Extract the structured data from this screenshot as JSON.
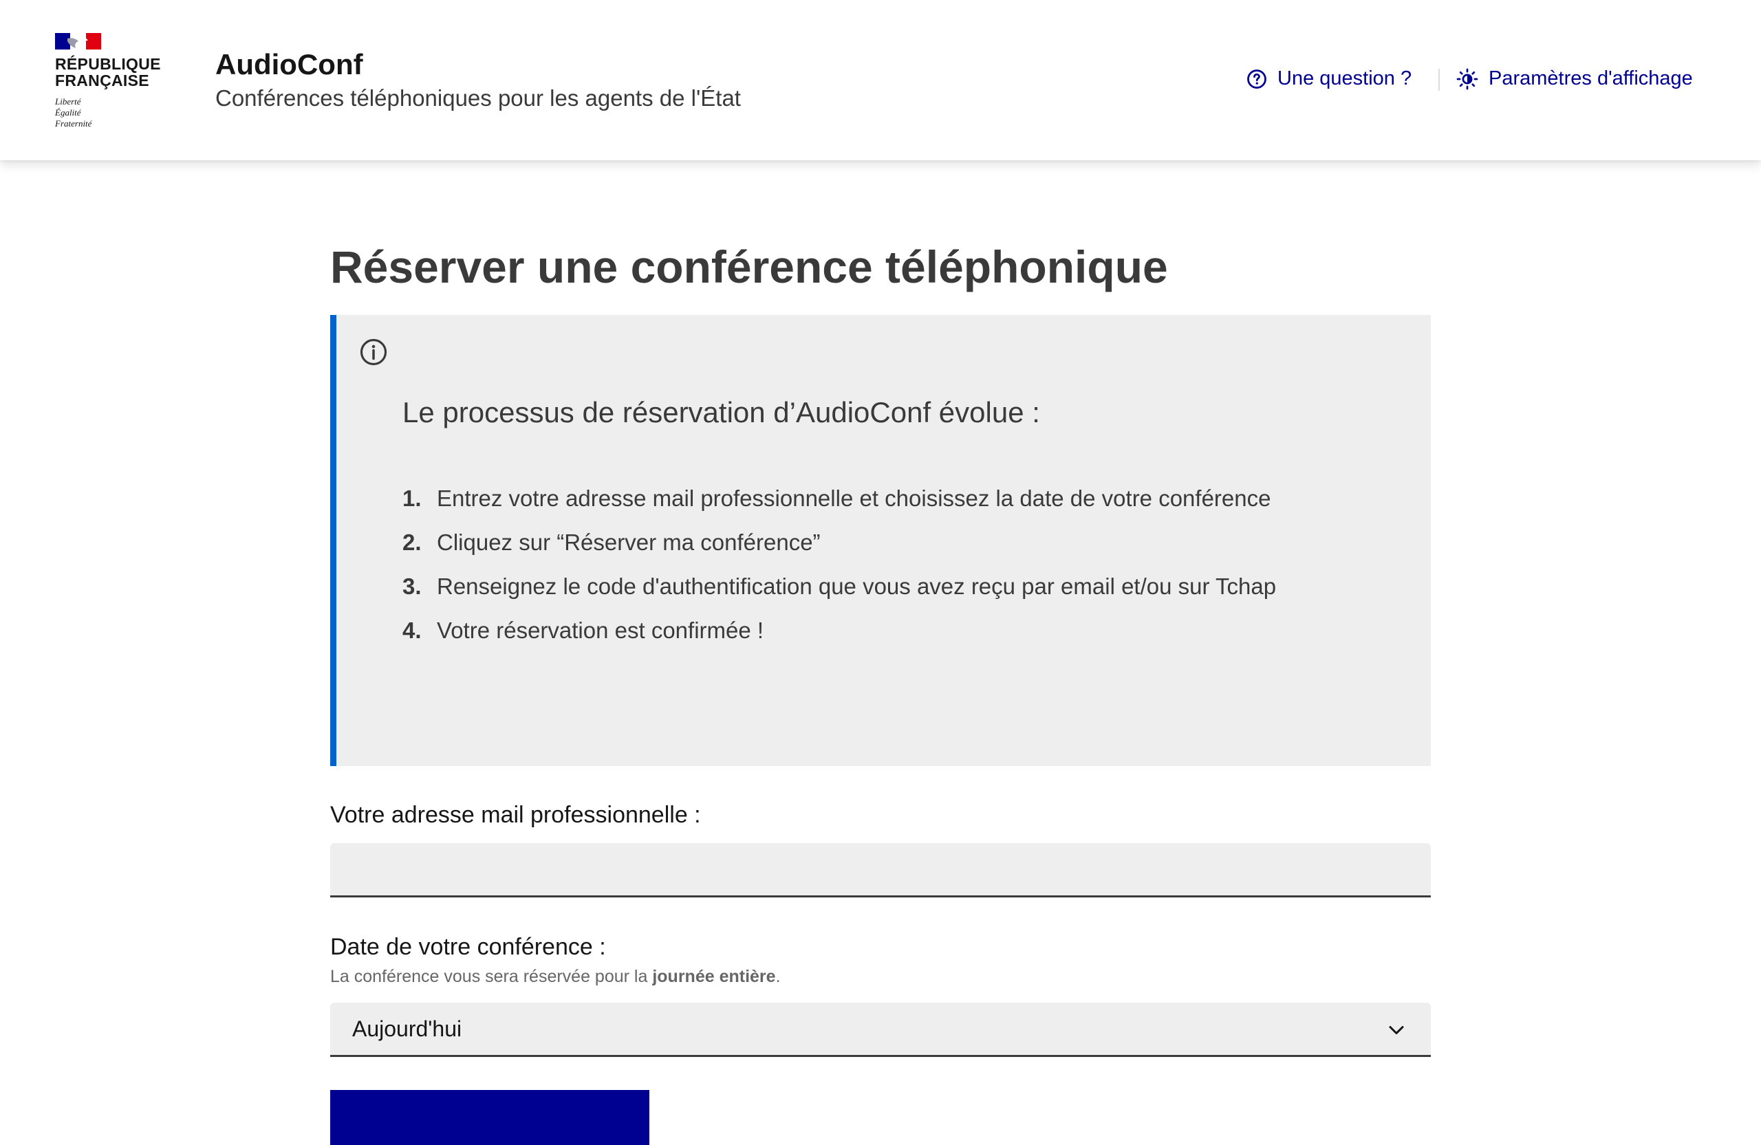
{
  "header": {
    "logo": {
      "line1": "RÉPUBLIQUE",
      "line2": "FRANÇAISE",
      "motto": [
        "Liberté",
        "Égalité",
        "Fraternité"
      ],
      "flag_colors": [
        "#000091",
        "#ffffff",
        "#e1000f"
      ]
    },
    "service_title": "AudioConf",
    "service_tagline": "Conférences téléphoniques pour les agents de l'État",
    "tools": {
      "question_label": "Une question ?",
      "question_icon": "question-circle-icon",
      "display_settings_label": "Paramètres d'affichage",
      "display_settings_icon": "theme-sun-icon"
    }
  },
  "main": {
    "title": "Réserver une conférence téléphonique",
    "callout": {
      "icon": "info-icon",
      "heading": "Le processus de réservation d’AudioConf évolue :",
      "steps": [
        {
          "num": "1.",
          "text": "Entrez votre adresse mail professionnelle et choisissez la date de votre conférence"
        },
        {
          "num": "2.",
          "text": "Cliquez sur “Réserver ma conférence”"
        },
        {
          "num": "3.",
          "text": "Renseignez le code d'authentification que vous avez reçu par email et/ou sur Tchap"
        },
        {
          "num": "4.",
          "text": "Votre réservation est confirmée !"
        }
      ]
    },
    "form": {
      "email_label": "Votre adresse mail professionnelle :",
      "email_value": "",
      "date_label": "Date de votre conférence :",
      "date_hint_prefix": "La conférence vous sera réservée pour la ",
      "date_hint_bold": "journée entière",
      "date_hint_suffix": ".",
      "date_selected": "Aujourd'hui"
    }
  },
  "colors": {
    "primary": "#000091",
    "callout_accent": "#0063cb",
    "callout_bg": "#eeeeee"
  }
}
